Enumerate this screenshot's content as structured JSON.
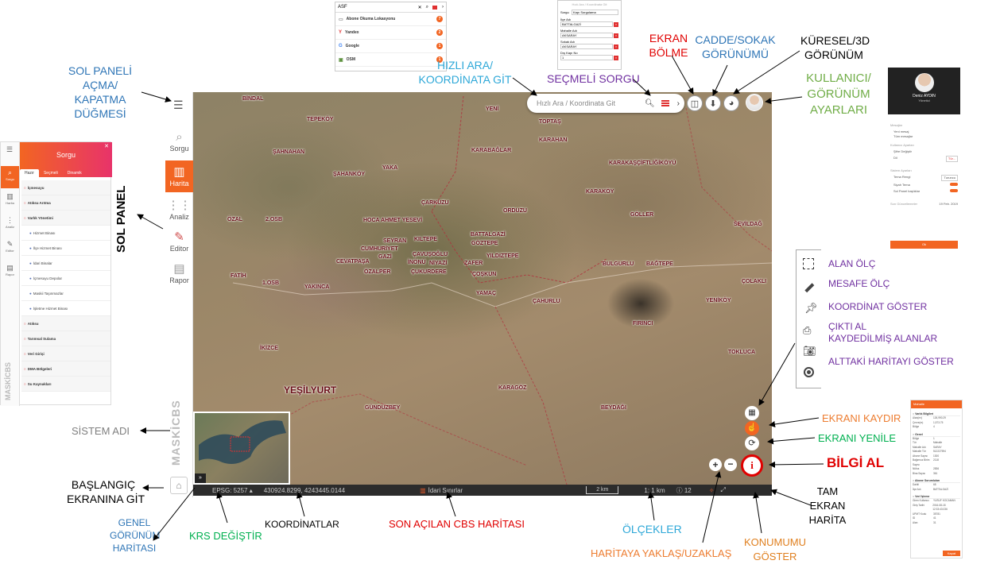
{
  "map": {
    "search_placeholder": "Hızlı Ara / Koordinata Git",
    "labels": [
      {
        "t": "BİNDAL"
      },
      {
        "t": "TEPEKÖY"
      },
      {
        "t": "ŞAHNAHAN"
      },
      {
        "t": "ŞAHANKÖY"
      },
      {
        "t": "YAKA"
      },
      {
        "t": "YENİ"
      },
      {
        "t": "TOPTAŞ"
      },
      {
        "t": "KARAHAN"
      },
      {
        "t": "KARABAĞLAR"
      },
      {
        "t": "KARAKAŞÇİFTLİĞİKÖYÜ"
      },
      {
        "t": "KARAKÖY"
      },
      {
        "t": "ÇARKUZU"
      },
      {
        "t": "ORDUZU"
      },
      {
        "t": "GÖLLER"
      },
      {
        "t": "SEVİLDAĞ"
      },
      {
        "t": "ÖZAL"
      },
      {
        "t": "2.OSB"
      },
      {
        "t": "HOCA AHMET YESEVİ"
      },
      {
        "t": "BATTALGAZİ"
      },
      {
        "t": "SEYRAN"
      },
      {
        "t": "KILTEPE"
      },
      {
        "t": "GÖZTEPE"
      },
      {
        "t": "CUMHURİYET"
      },
      {
        "t": "GAZİ"
      },
      {
        "t": "ÇAVUŞOĞLU"
      },
      {
        "t": "YILDIZTEPE"
      },
      {
        "t": "CEVATPAŞA"
      },
      {
        "t": "İNÖNÜ"
      },
      {
        "t": "NİYAZİ"
      },
      {
        "t": "ZAFER"
      },
      {
        "t": "ÖZALPER"
      },
      {
        "t": "ÇUKURDERE"
      },
      {
        "t": "ÇOŞKUN"
      },
      {
        "t": "BULGURLU"
      },
      {
        "t": "BAĞTEPE"
      },
      {
        "t": "FATİH"
      },
      {
        "t": "1.OSB"
      },
      {
        "t": "YAKINCA"
      },
      {
        "t": "YAMAÇ"
      },
      {
        "t": "ÇAHURLU"
      },
      {
        "t": "ÇOLAKLI"
      },
      {
        "t": "YENİKÖY"
      },
      {
        "t": "FIRINCI"
      },
      {
        "t": "İKİZCE"
      },
      {
        "t": "TOKLUCA"
      },
      {
        "t": "KARAGÖZ"
      },
      {
        "t": "GÜNDÜZBEY"
      },
      {
        "t": "BEYDAĞI"
      },
      {
        "t": "YEŞİLYURT"
      }
    ]
  },
  "bottombar": {
    "crs": "EPSG: 5257",
    "coords": "430924.8299,  4243445.0144",
    "last_map": "İdari Sınırlar",
    "scale_bar": "2 km",
    "scale": "1: 1 km",
    "zoom": "12"
  },
  "sidebar": {
    "items": [
      {
        "label": "Sorgu",
        "icon": "search-icon"
      },
      {
        "label": "Harita",
        "icon": "map-icon"
      },
      {
        "label": "Analiz",
        "icon": "analysis-icon"
      },
      {
        "label": "Editor",
        "icon": "pencil-icon"
      },
      {
        "label": "Rapor",
        "icon": "chart-icon"
      }
    ],
    "system_name": "MASKİCBS"
  },
  "annotations": {
    "sol_paneli": [
      "SOL PANELİ",
      "AÇMA/",
      "KAPATMA",
      "DÜĞMESİ"
    ],
    "hizli_ara": [
      "HIZLI ARA/",
      "KOORDİNATA GİT"
    ],
    "secmeli_sorgu": "SEÇMELİ SORGU",
    "ekran_bolme": [
      "EKRAN",
      "BÖLME"
    ],
    "cadde_sokak": [
      "CADDE/SOKAK",
      "GÖRÜNÜMÜ"
    ],
    "kuresel": [
      "KÜRESEL/3D",
      "GÖRÜNÜM"
    ],
    "kullanici": [
      "KULLANICI/",
      "GÖRÜNÜM",
      "AYARLARI"
    ],
    "sol_panel": "SOL PANEL",
    "alan_olc": "ALAN ÖLÇ",
    "mesafe_olc": "MESAFE ÖLÇ",
    "koordinat_goster": "KOORDİNAT GÖSTER",
    "cikti_al": [
      "ÇIKTI AL",
      "KAYDEDİLMİŞ ALANLAR"
    ],
    "alttaki_harita": "ALTTAKİ HARİTAYI GÖSTER",
    "ekrani_kaydir": "EKRANI KAYDIR",
    "ekrani_yenile": "EKRANI YENİLE",
    "bilgi_al": "BİLGİ AL",
    "sistem_adi": "SİSTEM ADI",
    "baslangic": [
      "BAŞLANGIÇ",
      "EKRANINA GİT"
    ],
    "genel_gorunum": [
      "GENEL",
      "GÖRÜNÜM",
      "HARİTASI"
    ],
    "krs": "KRS DEĞİŞTİR",
    "koordinatlar": "KOORDİNATLAR",
    "son_acilan": "SON AÇILAN CBS HARİTASI",
    "olcekler": "ÖLÇEKLER",
    "yaklas": "HARİTAYA YAKLAŞ/UZAKLAŞ",
    "konumumu": [
      "KONUMUMU",
      "GÖSTER"
    ],
    "tam_ekran": [
      "TAM",
      "EKRAN",
      "HARİTA"
    ]
  },
  "search_popup": {
    "query": "ASF",
    "results": [
      {
        "label": "Abone Okuma Lokasyonu",
        "count": "7"
      },
      {
        "label": "Yandex",
        "count": "2"
      },
      {
        "label": "Google",
        "count": "1"
      },
      {
        "label": "OSM",
        "count": "1"
      }
    ]
  },
  "query_popup": {
    "title": "Hızlı Ara / Koordinata Git",
    "sorgu": "Sorgu",
    "sorgu_value": "Kapı Sorgulama",
    "fields": [
      {
        "label": "İlçe Adı",
        "value": "BATTALGAZİ"
      },
      {
        "label": "Mahalle Adı",
        "value": "AKSARAY"
      },
      {
        "label": "Sokak Adı",
        "value": "AKSARAY"
      },
      {
        "label": "Dış Kapı No",
        "value": "1"
      }
    ]
  },
  "left_panel": {
    "header": "Sorgu",
    "tabs": [
      "Hazır",
      "Seçmeli",
      "Dinamik"
    ],
    "items": [
      {
        "label": "İçmesuyu",
        "group": true
      },
      {
        "label": "Atıksu Arıtma",
        "group": true
      },
      {
        "label": "Varlık Yönetimi",
        "group": true
      },
      {
        "label": "Hizmet Binası",
        "group": false
      },
      {
        "label": "İlçe Hizmet Binası",
        "group": false
      },
      {
        "label": "İdari Binalar",
        "group": false
      },
      {
        "label": "İçmesuyu Depolar",
        "group": false
      },
      {
        "label": "Maskii Taşınmazlar",
        "group": false
      },
      {
        "label": "İşletme Hizmet Binası",
        "group": false
      },
      {
        "label": "Atıksu",
        "group": true
      },
      {
        "label": "Tarımsal Sulama",
        "group": true
      },
      {
        "label": "Veri Girişi",
        "group": true
      },
      {
        "label": "DMA Bölgeleri",
        "group": true
      },
      {
        "label": "Su Kaynakları",
        "group": true
      }
    ],
    "side_items": [
      "Sorgu",
      "Harita",
      "Analiz",
      "Editor",
      "Rapor"
    ],
    "system_name": "MASKİCBS"
  },
  "user_panel": {
    "name": "Deniz AYDIN",
    "role": "Yönetici",
    "messages": "Mesajlar",
    "new_message": "Yeni mesaj",
    "all_messages": "Tüm mesajlar",
    "user_settings": "Kullanıcı Ayarları",
    "change_password": "Şifre Değiştir",
    "language": "Dil",
    "language_value": "Tür...",
    "system_settings": "Sistem Ayarları",
    "theme_color": "Tema Rengi",
    "theme_value": "Turuncu",
    "dark_theme": "Siyah Tema",
    "left_panel_open": "Sol Panel başlıklar",
    "last_update": "Son Güncellemeler",
    "last_update_date": "19 Feb. 2019",
    "button": "Ok"
  },
  "info_panel": {
    "title": "Mahalle",
    "sections": [
      {
        "title": "Varlık Bilgileri",
        "rows": [
          [
            "Alan(m²)",
            "126,990.29"
          ],
          [
            "Çevre(m)",
            "1,573.75"
          ],
          [
            "Bölge",
            "4"
          ]
        ]
      },
      {
        "title": "Genel",
        "rows": [
          [
            "Bölge",
            "1"
          ],
          [
            "Tür",
            "Mahalle"
          ],
          [
            "Mahalle Adı",
            "SARAY"
          ],
          [
            "Mahalle Tür",
            "512227594"
          ],
          [
            "Abone Sayısı",
            "1300"
          ],
          [
            "Bağımsız Birim Sayısı",
            "2118"
          ],
          [
            "Nüfus",
            "2836"
          ],
          [
            "Bina Sayısı",
            "361"
          ]
        ]
      },
      {
        "title": "Abone Sorumluları",
        "rows": [
          [
            "Dahili",
            "68"
          ],
          [
            "İlçe Adı",
            "BATTALGAZİ"
          ]
        ]
      },
      {
        "title": "Veri İşleme",
        "rows": [
          [
            "Giren Kullanıcı",
            "YUSUF KOCAMAN"
          ],
          [
            "Giriş Tarihi",
            "2016-08-18 12:33:43.036"
          ],
          [
            "UPMT Kodu",
            "35781"
          ],
          [
            "ID",
            "41"
          ],
          [
            "Alan",
            "31"
          ]
        ]
      }
    ],
    "button": "Kapat"
  },
  "colors": {
    "accent": "#f26522",
    "annotation_blue": "#2e75b6",
    "annotation_green": "#70ad47",
    "annotation_purple": "#7030a0",
    "annotation_orange": "#ed7d31",
    "annotation_red": "#e00000",
    "annotation_gray": "#7f7f7f"
  }
}
